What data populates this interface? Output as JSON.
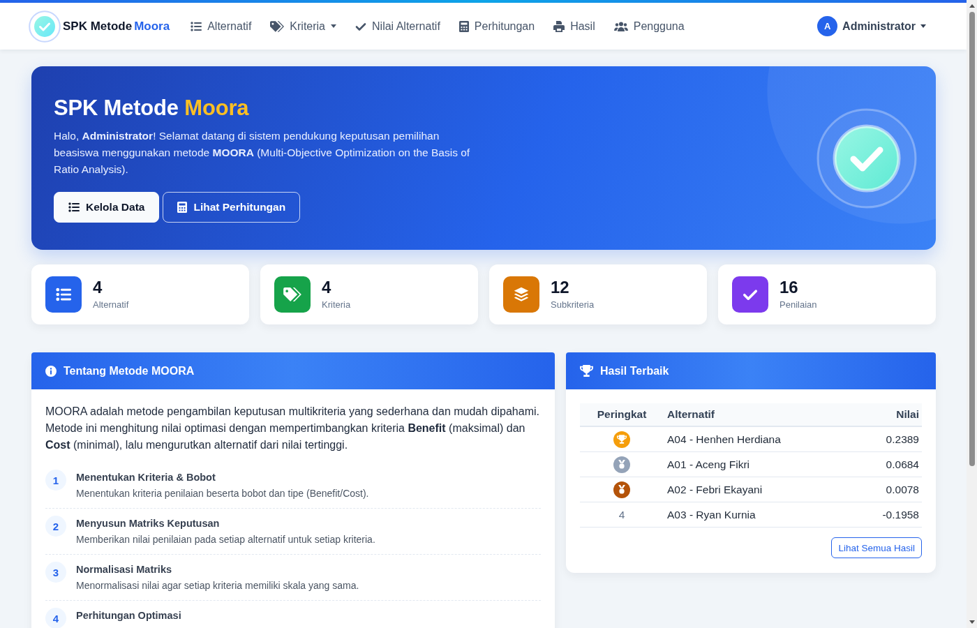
{
  "navbar": {
    "brand": {
      "name": "SPK Metode",
      "highlight": "Moora"
    },
    "items": [
      {
        "label": "Alternatif",
        "kind": "link",
        "selected": false
      },
      {
        "label": "Kriteria",
        "kind": "dropdown",
        "selected": false
      },
      {
        "label": "Nilai Alternatif",
        "kind": "link",
        "selected": false
      },
      {
        "label": "Perhitungan",
        "kind": "link",
        "selected": false
      },
      {
        "label": "Hasil",
        "kind": "link",
        "selected": false
      },
      {
        "label": "Pengguna",
        "kind": "link",
        "selected": false
      }
    ],
    "user": {
      "initial": "A",
      "name": "Administrator"
    }
  },
  "hero": {
    "title": "SPK Metode",
    "title_highlight": "Moora",
    "text": "Halo, **Administrator**! Selamat datang di sistem pendukung keputusan pemilihan beasiswa menggunakan metode **MOORA** (Multi-Objective Optimization on the Basis of Ratio Analysis).",
    "buttons": [
      {
        "label": "Kelola Data",
        "kind": "solid"
      },
      {
        "label": "Lihat Perhitungan",
        "kind": "outline"
      }
    ]
  },
  "stats": [
    {
      "value": "4",
      "label": "Alternatif",
      "color": "#2563eb"
    },
    {
      "value": "4",
      "label": "Kriteria",
      "color": "#16a34a"
    },
    {
      "value": "12",
      "label": "Subkriteria",
      "color": "#d97706"
    },
    {
      "value": "16",
      "label": "Penilaian",
      "color": "#7c3aed"
    }
  ],
  "about": {
    "title": "Tentang Metode MOORA",
    "text": "MOORA adalah metode pengambilan keputusan multikriteria yang sederhana dan mudah dipahami. Metode ini menghitung nilai optimasi dengan mempertimbangkan kriteria **Benefit** (maksimal) dan **Cost** (minimal), lalu mengurutkan alternatif dari nilai tertinggi.",
    "steps": [
      {
        "number": "1",
        "title": "Menentukan Kriteria & Bobot",
        "description": "Menentukan kriteria penilaian beserta bobot dan tipe (Benefit/Cost)."
      },
      {
        "number": "2",
        "title": "Menyusun Matriks Keputusan",
        "description": "Memberikan nilai penilaian pada setiap alternatif untuk setiap kriteria."
      },
      {
        "number": "3",
        "title": "Normalisasi Matriks",
        "description": "Menormalisasi nilai agar setiap kriteria memiliki skala yang sama."
      },
      {
        "number": "4",
        "title": "Perhitungan Optimasi"
      }
    ]
  },
  "best_results": {
    "title": "Hasil Terbaik",
    "columns": [
      "Peringkat",
      "Alternatif",
      "Nilai"
    ],
    "rows": [
      {
        "kind": "trophy",
        "color": "#f59e0b",
        "alternative": "A04 - Henhen Herdiana",
        "value": "0.2389"
      },
      {
        "kind": "medal",
        "color": "#94a3b8",
        "alternative": "A01 - Aceng Fikri",
        "value": "0.0684"
      },
      {
        "kind": "medal",
        "color": "#b45309",
        "alternative": "A02 - Febri Ekayani",
        "value": "0.0078"
      },
      {
        "kind": "number",
        "rank": "4",
        "alternative": "A03 - Ryan Kurnia",
        "value": "-0.1958"
      }
    ],
    "button": "Lihat Semua Hasil"
  }
}
